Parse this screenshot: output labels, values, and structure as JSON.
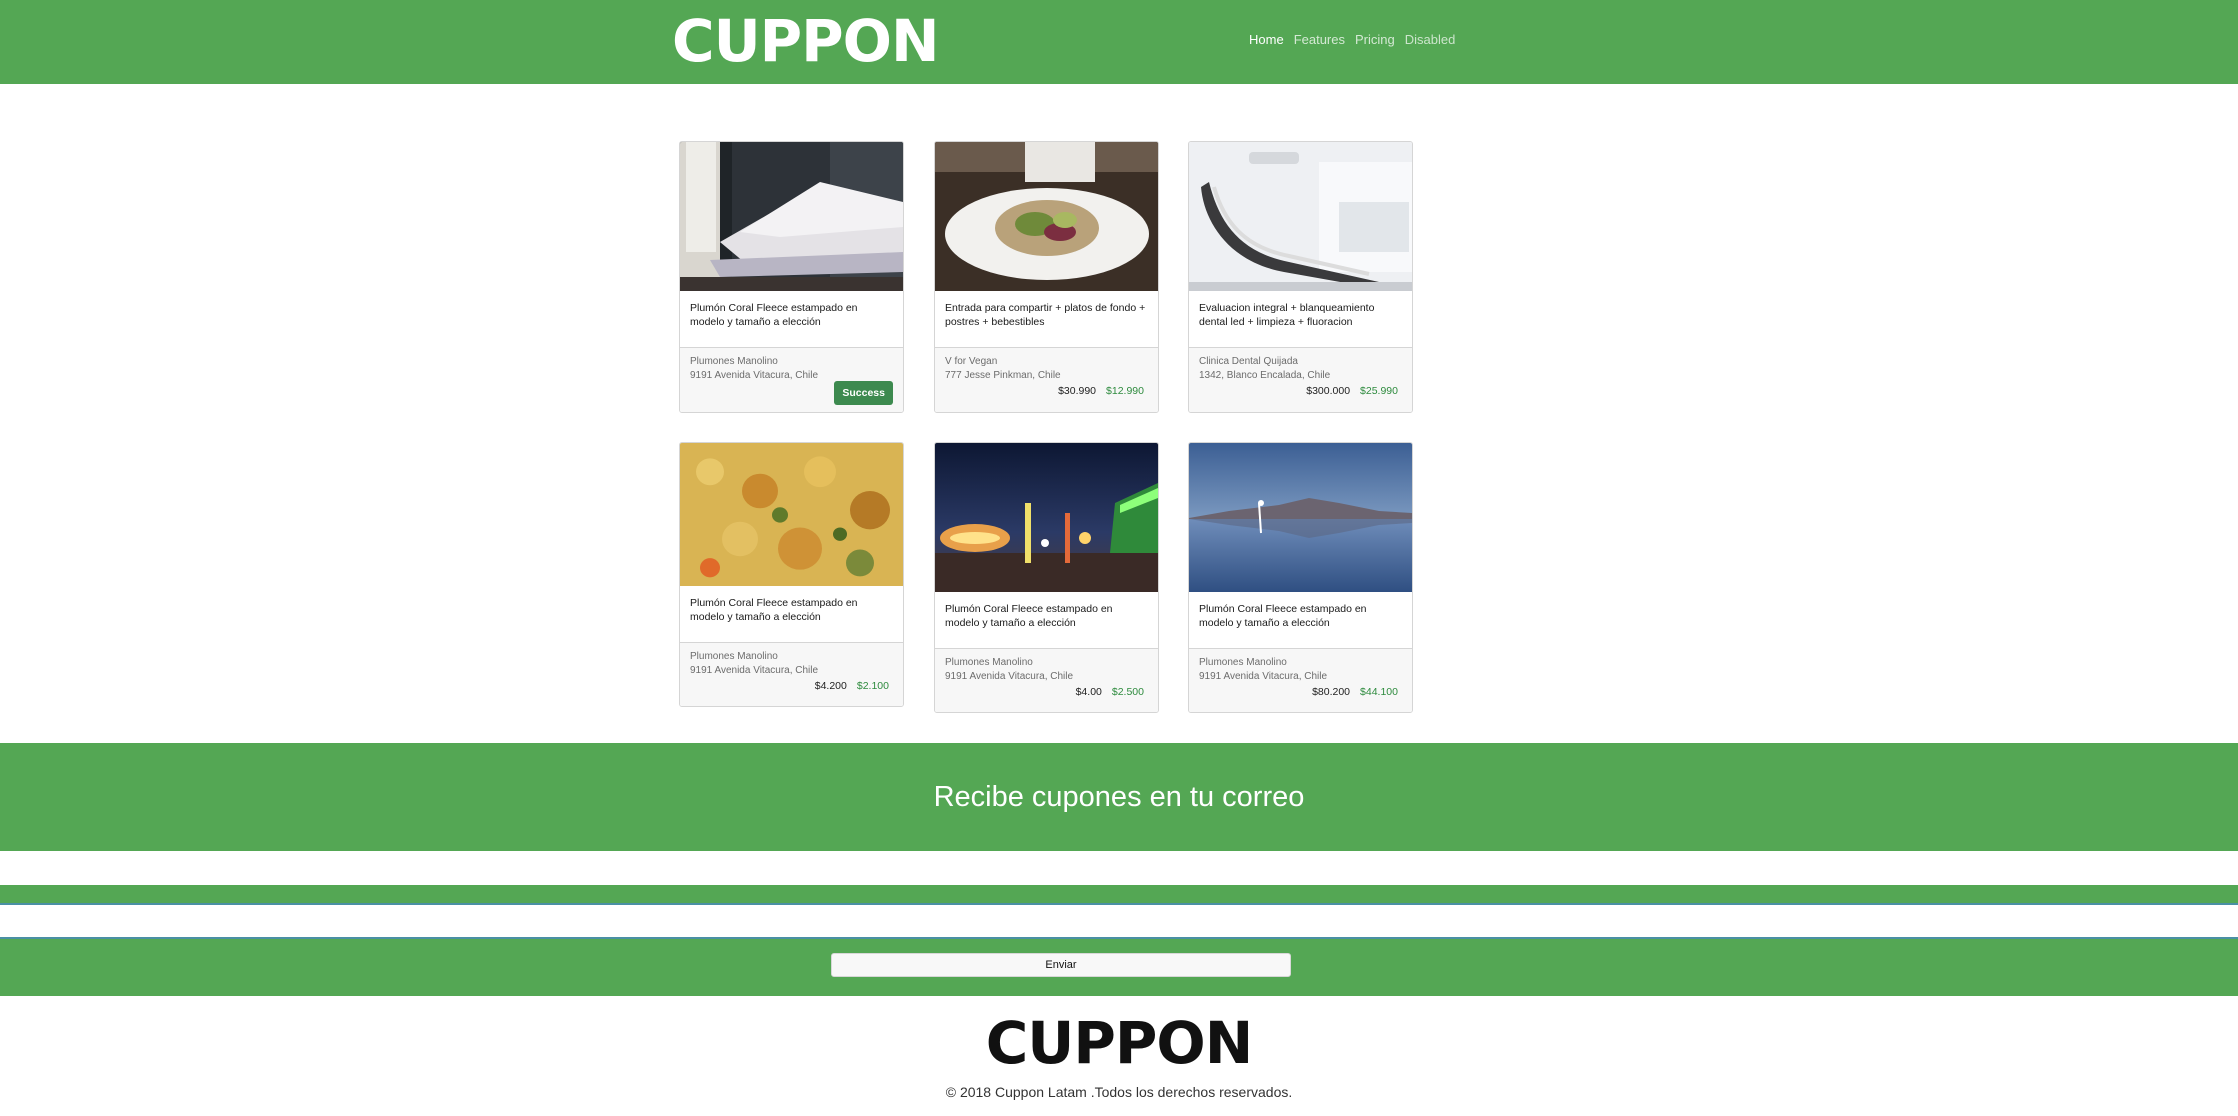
{
  "header": {
    "brand": "CUPPON",
    "nav": [
      {
        "label": "Home"
      },
      {
        "label": "Features"
      },
      {
        "label": "Pricing"
      },
      {
        "label": "Disabled"
      }
    ]
  },
  "cards": [
    {
      "image": "bedroom-photo",
      "title": "Plumón Coral Fleece estampado en modelo y tamaño a elección",
      "merchant": "Plumones Manolino",
      "address": "9191 Avenida Vitacura, Chile",
      "button_label": "Success"
    },
    {
      "image": "salad-plate-photo",
      "title": "Entrada para compartir + platos de fondo + postres + bebestibles",
      "merchant": "V for Vegan",
      "address": "777 Jesse Pinkman, Chile",
      "price_old": "$30.990",
      "price_new": "$12.990"
    },
    {
      "image": "dental-chair-photo",
      "title": "Evaluacion integral + blanqueamiento dental led + limpieza + fluoracion",
      "merchant": "Clinica Dental Quijada",
      "address": "1342, Blanco Encalada, Chile",
      "price_old": "$300.000",
      "price_new": "$25.990"
    },
    {
      "image": "chickpea-stew-photo",
      "title": "Plumón Coral Fleece estampado en modelo y tamaño a elección",
      "merchant": "Plumones Manolino",
      "address": "9191 Avenida Vitacura, Chile",
      "price_old": "$4.200",
      "price_new": "$2.100"
    },
    {
      "image": "night-fair-photo",
      "title": "Plumón Coral Fleece estampado en modelo y tamaño a elección",
      "merchant": "Plumones Manolino",
      "address": "9191 Avenida Vitacura, Chile",
      "price_old": "$4.00",
      "price_new": "$2.500"
    },
    {
      "image": "salt-lake-photo",
      "title": "Plumón Coral Fleece estampado en modelo y tamaño a elección",
      "merchant": "Plumones Manolino",
      "address": "9191 Avenida Vitacura, Chile",
      "price_old": "$80.200",
      "price_new": "$44.100"
    }
  ],
  "newsletter": {
    "title": "Recibe cupones en tu correo",
    "send_label": "Enviar"
  },
  "footer": {
    "brand": "CUPPON",
    "copyright": "© 2018 Cuppon Latam .Todos los derechos reservados."
  },
  "colors": {
    "brand_green": "#54a754",
    "price_green": "#2e8b3e",
    "success_button": "#3d8a4f"
  }
}
